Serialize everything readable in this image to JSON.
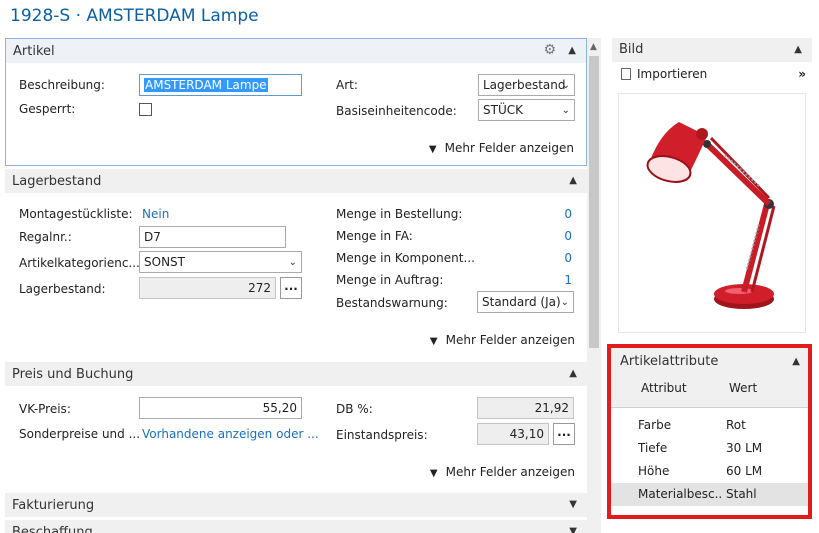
{
  "page_title": "1928-S · AMSTERDAM Lampe",
  "artikel": {
    "title": "Artikel",
    "beschreibung_label": "Beschreibung:",
    "beschreibung_value": "AMSTERDAM Lampe",
    "gesperrt_label": "Gesperrt:",
    "art_label": "Art:",
    "art_value": "Lagerbestand",
    "basis_label": "Basiseinheitencode:",
    "basis_value": "STÜCK",
    "more_label": "Mehr Felder anzeigen"
  },
  "lager": {
    "title": "Lagerbestand",
    "montage_label": "Montagestückliste:",
    "montage_value": "Nein",
    "regal_label": "Regalnr.:",
    "regal_value": "D7",
    "kategorie_label": "Artikelkategorienc...",
    "kategorie_value": "SONST",
    "bestand_label": "Lagerbestand:",
    "bestand_value": "272",
    "dots": "...",
    "bestellung_label": "Menge in Bestellung:",
    "bestellung_value": "0",
    "fa_label": "Menge in FA:",
    "fa_value": "0",
    "komponent_label": "Menge in Komponent...",
    "komponent_value": "0",
    "auftrag_label": "Menge in Auftrag:",
    "auftrag_value": "1",
    "warnung_label": "Bestandswarnung:",
    "warnung_value": "Standard (Ja)",
    "more_label": "Mehr Felder anzeigen"
  },
  "preis": {
    "title": "Preis und Buchung",
    "vk_label": "VK-Preis:",
    "vk_value": "55,20",
    "sonder_label": "Sonderpreise und ...",
    "sonder_value": "Vorhandene anzeigen oder ...",
    "db_label": "DB %:",
    "db_value": "21,92",
    "einstand_label": "Einstandspreis:",
    "einstand_value": "43,10",
    "dots": "...",
    "more_label": "Mehr Felder anzeigen"
  },
  "fakturierung": {
    "title": "Fakturierung"
  },
  "beschaffung": {
    "title": "Beschaffung"
  },
  "bild": {
    "title": "Bild",
    "import_label": "Importieren",
    "more_symbol": "»"
  },
  "attribute": {
    "title": "Artikelattribute",
    "col_attr": "Attribut",
    "col_wert": "Wert",
    "rows": [
      {
        "attr": "Farbe",
        "wert": "Rot"
      },
      {
        "attr": "Tiefe",
        "wert": "30 LM"
      },
      {
        "attr": "Höhe",
        "wert": "60 LM"
      },
      {
        "attr": "Materialbesc...",
        "wert": "Stahl"
      }
    ]
  },
  "colors": {
    "accent": "#0b5fa5",
    "link": "#1a6fc0",
    "highlight_border": "#e21c1c",
    "lamp_red": "#d01f2a"
  }
}
